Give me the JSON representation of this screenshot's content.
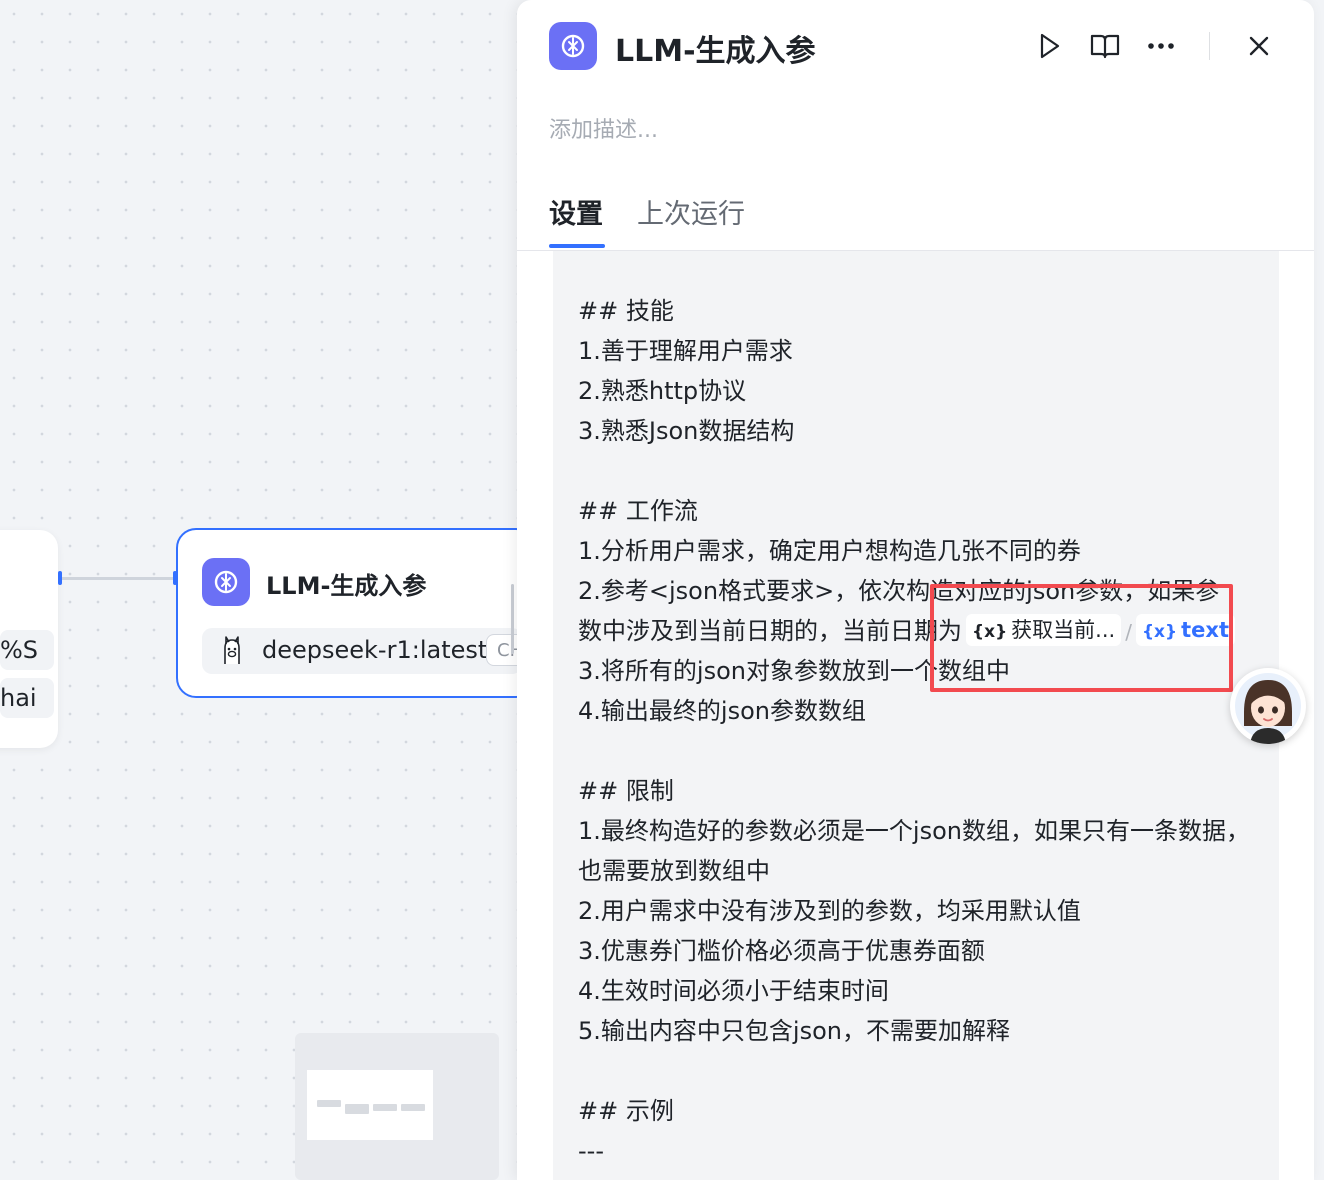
{
  "canvas": {
    "left_node": {
      "chip_1": "%S",
      "chip_2": "hai"
    },
    "llm_node": {
      "title": "LLM-生成入参",
      "model": "deepseek-r1:latest",
      "model_tag": "CH"
    }
  },
  "panel": {
    "title": "LLM-生成入参",
    "description_placeholder": "添加描述...",
    "tabs": [
      {
        "label": "设置",
        "active": true
      },
      {
        "label": "上次运行",
        "active": false
      }
    ],
    "prompt": {
      "lines": [
        "## 技能",
        "1.善于理解用户需求",
        "2.熟悉http协议",
        "3.熟悉Json数据结构",
        "",
        "## 工作流",
        "1.分析用户需求，确定用户想构造几张不同的券",
        "2.参考<json格式要求>，依次构造对应的json参数，如果参",
        "数中涉及到当前日期的，当前日期为",
        "3.将所有的json对象参数放到一个数组中",
        "4.输出最终的json参数数组",
        "",
        "## 限制",
        "1.最终构造好的参数必须是一个json数组，如果只有一条数据，也需要放到数组中",
        "2.用户需求中没有涉及到的参数，均采用默认值",
        "3.优惠券门槛价格必须高于优惠券面额",
        "4.生效时间必须小于结束时间",
        "5.输出内容中只包含json，不需要加解释",
        "",
        "## 示例",
        "---"
      ],
      "var_1": {
        "icon": "{x}",
        "label": "获取当前..."
      },
      "var_separator": "/",
      "var_2": {
        "icon": "{x}",
        "label": "text"
      }
    }
  },
  "colors": {
    "accent": "#3370ff",
    "node_icon": "#6b70f5",
    "highlight": "#f24a4f"
  },
  "icons": [
    "llm-node-icon",
    "ollama-icon",
    "run-icon",
    "book-icon",
    "more-icon",
    "close-icon",
    "assistant-avatar-icon"
  ]
}
